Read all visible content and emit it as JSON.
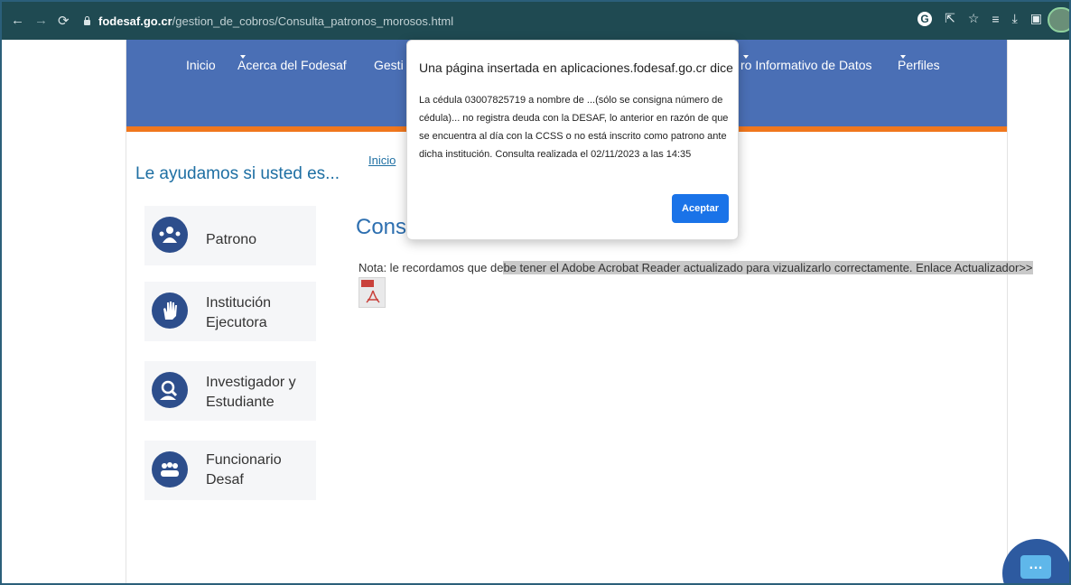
{
  "browser": {
    "url_host": "fodesaf.go.cr",
    "url_path": "/gestion_de_cobros/Consulta_patronos_morosos.html",
    "back_icon": "arrow-left",
    "forward_icon": "arrow-right",
    "reload_icon": "reload",
    "google_icon_letter": "G"
  },
  "nav": {
    "items": [
      {
        "label": "Inicio"
      },
      {
        "label": "Acerca del Fodesaf"
      },
      {
        "label": "Gesti"
      },
      {
        "label": "ro Informativo de Datos"
      },
      {
        "label": "Perfiles"
      }
    ]
  },
  "sidebar": {
    "title": "Le ayudamos si usted es...",
    "items": [
      {
        "line1": "Patrono",
        "line2": ""
      },
      {
        "line1": "Institución",
        "line2": "Ejecutora"
      },
      {
        "line1": "Investigador y",
        "line2": "Estudiante"
      },
      {
        "line1": "Funcionario",
        "line2": "Desaf"
      }
    ]
  },
  "main": {
    "breadcrumb": "Inicio",
    "heading": "Consu",
    "note_plain": "Nota: le recordamos que de",
    "note_highlight": "be tener el Adobe Acrobat Reader actualizado para vizualizarlo correctamente.  Enlace Actualizador>>"
  },
  "dialog": {
    "title": "Una página insertada en aplicaciones.fodesaf.go.cr dice",
    "message": "La cédula 03007825719 a nombre de ...(sólo se consigna número de cédula)... no registra deuda con la DESAF, lo anterior en razón de que se encuentra al día con la CCSS o no está inscrito como patrono ante dicha institución. Consulta realizada el 02/11/2023 a las 14:35",
    "button": "Aceptar"
  },
  "colors": {
    "header_blue": "#4a6fb5",
    "accent_orange": "#f0771d",
    "button_blue": "#1a73e8",
    "chrome_bg": "#1f4a52"
  }
}
